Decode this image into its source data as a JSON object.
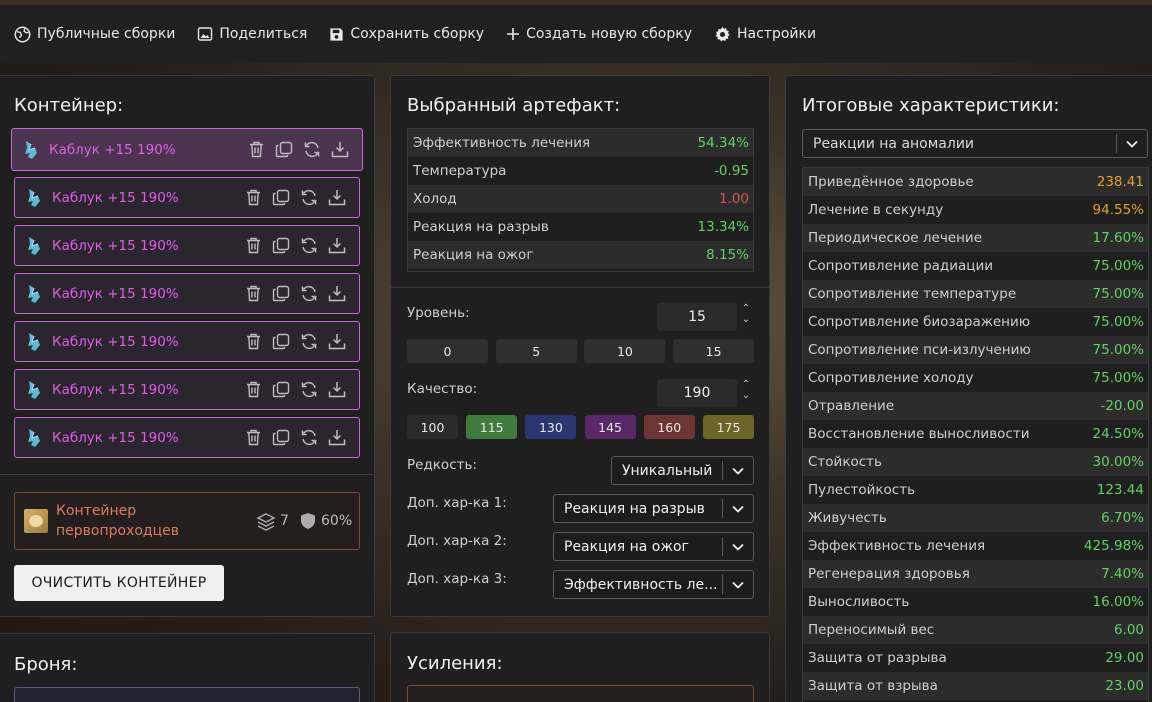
{
  "toolbar": {
    "public_builds": "Публичные сборки",
    "share": "Поделиться",
    "save_build": "Сохранить сборку",
    "new_build": "Создать новую сборку",
    "settings": "Настройки"
  },
  "container": {
    "title": "Контейнер:",
    "items": [
      {
        "name": "Каблук +15 190%"
      },
      {
        "name": "Каблук +15 190%"
      },
      {
        "name": "Каблук +15 190%"
      },
      {
        "name": "Каблук +15 190%"
      },
      {
        "name": "Каблук +15 190%"
      },
      {
        "name": "Каблук +15 190%"
      },
      {
        "name": "Каблук +15 190%"
      }
    ],
    "box_name": "Контейнер первопроходцев",
    "capacity": "7",
    "protection": "60%",
    "clear_button": "ОЧИСТИТЬ КОНТЕЙНЕР"
  },
  "armor": {
    "title": "Броня:"
  },
  "selected": {
    "title": "Выбранный артефакт:",
    "stats": [
      {
        "label": "Эффективность лечения",
        "value": "54.34%",
        "color": "#5fd35f"
      },
      {
        "label": "Температура",
        "value": "-0.95",
        "color": "#5fd35f"
      },
      {
        "label": "Холод",
        "value": "1.00",
        "color": "#e05050"
      },
      {
        "label": "Реакция на разрыв",
        "value": "13.34%",
        "color": "#5fd35f"
      },
      {
        "label": "Реакция на ожог",
        "value": "8.15%",
        "color": "#5fd35f"
      }
    ],
    "level_label": "Уровень:",
    "level_value": "15",
    "level_presets": [
      "0",
      "5",
      "10",
      "15"
    ],
    "quality_label": "Качество:",
    "quality_value": "190",
    "quality_presets": [
      {
        "label": "100",
        "color": "#2a2a2a"
      },
      {
        "label": "115",
        "color": "#3f7a3f"
      },
      {
        "label": "130",
        "color": "#2a3670"
      },
      {
        "label": "145",
        "color": "#5a2868"
      },
      {
        "label": "160",
        "color": "#6e3434"
      },
      {
        "label": "175",
        "color": "#6e6428"
      }
    ],
    "rarity_label": "Редкость:",
    "rarity_value": "Уникальный",
    "extra1_label": "Доп. хар-ка 1:",
    "extra1_value": "Реакция на разрыв",
    "extra2_label": "Доп. хар-ка 2:",
    "extra2_value": "Реакция на ожог",
    "extra3_label": "Доп. хар-ка 3:",
    "extra3_value": "Эффективность ле..."
  },
  "boosts": {
    "title": "Усиления:"
  },
  "totals": {
    "title": "Итоговые характеристики:",
    "filter_value": "Реакции на аномалии",
    "stats": [
      {
        "label": "Приведённое здоровье",
        "value": "238.41",
        "color": "#e0a030"
      },
      {
        "label": "Лечение в секунду",
        "value": "94.55%",
        "color": "#e0a030"
      },
      {
        "label": "Периодическое лечение",
        "value": "17.60%",
        "color": "#5fd35f"
      },
      {
        "label": "Сопротивление радиации",
        "value": "75.00%",
        "color": "#5fd35f"
      },
      {
        "label": "Сопротивление температуре",
        "value": "75.00%",
        "color": "#5fd35f"
      },
      {
        "label": "Сопротивление биозаражению",
        "value": "75.00%",
        "color": "#5fd35f"
      },
      {
        "label": "Сопротивление пси-излучению",
        "value": "75.00%",
        "color": "#5fd35f"
      },
      {
        "label": "Сопротивление холоду",
        "value": "75.00%",
        "color": "#5fd35f"
      },
      {
        "label": "Отравление",
        "value": "-20.00",
        "color": "#5fd35f"
      },
      {
        "label": "Восстановление выносливости",
        "value": "24.50%",
        "color": "#5fd35f"
      },
      {
        "label": "Стойкость",
        "value": "30.00%",
        "color": "#5fd35f"
      },
      {
        "label": "Пулестойкость",
        "value": "123.44",
        "color": "#5fd35f"
      },
      {
        "label": "Живучесть",
        "value": "6.70%",
        "color": "#5fd35f"
      },
      {
        "label": "Эффективность лечения",
        "value": "425.98%",
        "color": "#5fd35f"
      },
      {
        "label": "Регенерация здоровья",
        "value": "7.40%",
        "color": "#5fd35f"
      },
      {
        "label": "Выносливость",
        "value": "16.00%",
        "color": "#5fd35f"
      },
      {
        "label": "Переносимый вес",
        "value": "6.00",
        "color": "#5fd35f"
      },
      {
        "label": "Защита от разрыва",
        "value": "29.00",
        "color": "#5fd35f"
      },
      {
        "label": "Защита от взрыва",
        "value": "23.00",
        "color": "#5fd35f"
      }
    ]
  }
}
